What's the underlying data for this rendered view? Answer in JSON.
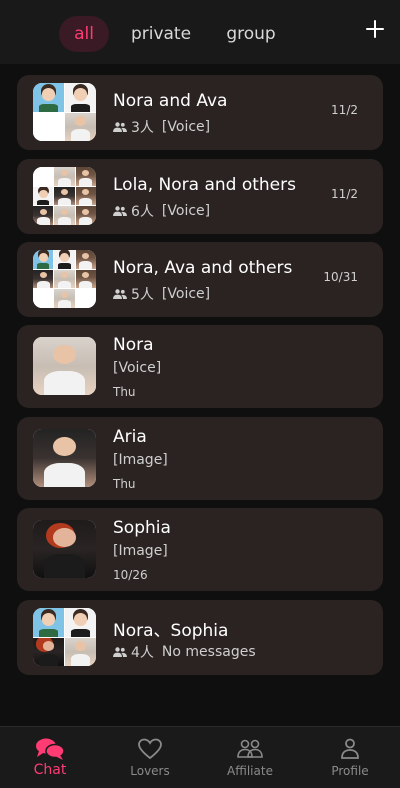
{
  "tabs": {
    "all": "all",
    "private": "private",
    "group": "group",
    "active": "all"
  },
  "icons": {
    "add": "plus-icon",
    "people": "people-icon"
  },
  "colors": {
    "accent": "#ff3b74",
    "card_bg": "#2a2322",
    "background": "#0f0f0f"
  },
  "chats": [
    {
      "name": "Nora and Ava",
      "count": "3人",
      "preview": "[Voice]",
      "time": "11/2"
    },
    {
      "name": "Lola, Nora and others",
      "count": "6人",
      "preview": "[Voice]",
      "time": "11/2"
    },
    {
      "name": "Nora, Ava and others",
      "count": "5人",
      "preview": "[Voice]",
      "time": "10/31"
    },
    {
      "name": "Nora",
      "preview": "[Voice]",
      "time": "Thu"
    },
    {
      "name": "Aria",
      "preview": "[Image]",
      "time": "Thu"
    },
    {
      "name": "Sophia",
      "preview": "[Image]",
      "time": "10/26"
    },
    {
      "name": "Nora、Sophia",
      "count": "4人",
      "preview": "No messages"
    }
  ],
  "nav": {
    "chat": "Chat",
    "lovers": "Lovers",
    "affiliate": "Affiliate",
    "profile": "Profile",
    "active": "Chat"
  }
}
